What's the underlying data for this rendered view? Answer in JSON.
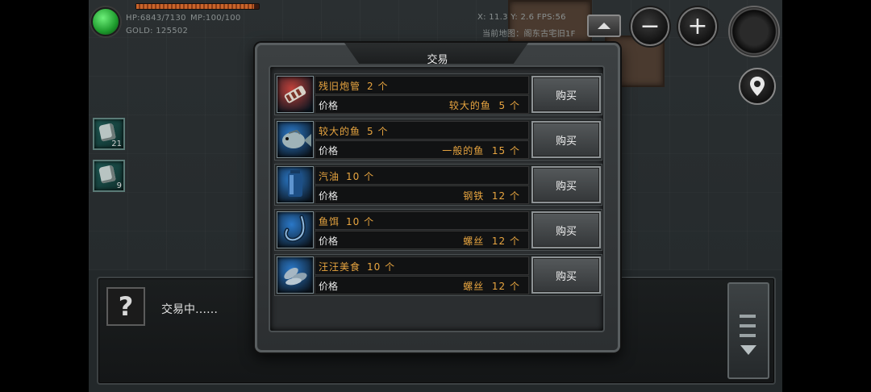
{
  "hud": {
    "hp": "HP:6843/7130",
    "mp": "MP:100/100",
    "gold": "GOLD: 125502",
    "coords": "X: 11.3 Y: 2.6  FPS:56",
    "map_name": "当前地图：阁东古宅旧1F",
    "hp_fraction": 0.96
  },
  "quick_slots": [
    {
      "count": "21",
      "icon": "bomb-icon"
    },
    {
      "count": "9",
      "icon": "grenade-icon"
    }
  ],
  "controls": {
    "zoom_out": "−",
    "zoom_in": "+"
  },
  "trade": {
    "title": "交易",
    "price_label": "价格",
    "buy_label": "购买",
    "items": [
      {
        "name": "残旧炮管",
        "qty": "2 个",
        "cost_item": "较大的鱼",
        "cost_qty": "5 个",
        "icon": "gun-barrel-icon",
        "color": "#c0403a"
      },
      {
        "name": "较大的鱼",
        "qty": "5 个",
        "cost_item": "一般的鱼",
        "cost_qty": "15 个",
        "icon": "fish-icon",
        "color": "#2a78c8"
      },
      {
        "name": "汽油",
        "qty": "10 个",
        "cost_item": "钢铁",
        "cost_qty": "12 个",
        "icon": "fuel-can-icon",
        "color": "#2a78c8"
      },
      {
        "name": "鱼饵",
        "qty": "10 个",
        "cost_item": "螺丝",
        "cost_qty": "12 个",
        "icon": "fish-hook-icon",
        "color": "#2a78c8"
      },
      {
        "name": "汪汪美食",
        "qty": "10 个",
        "cost_item": "螺丝",
        "cost_qty": "12 个",
        "icon": "dog-food-icon",
        "color": "#2a78c8"
      }
    ]
  },
  "dialog": {
    "text": "交易中……",
    "help_symbol": "?"
  }
}
